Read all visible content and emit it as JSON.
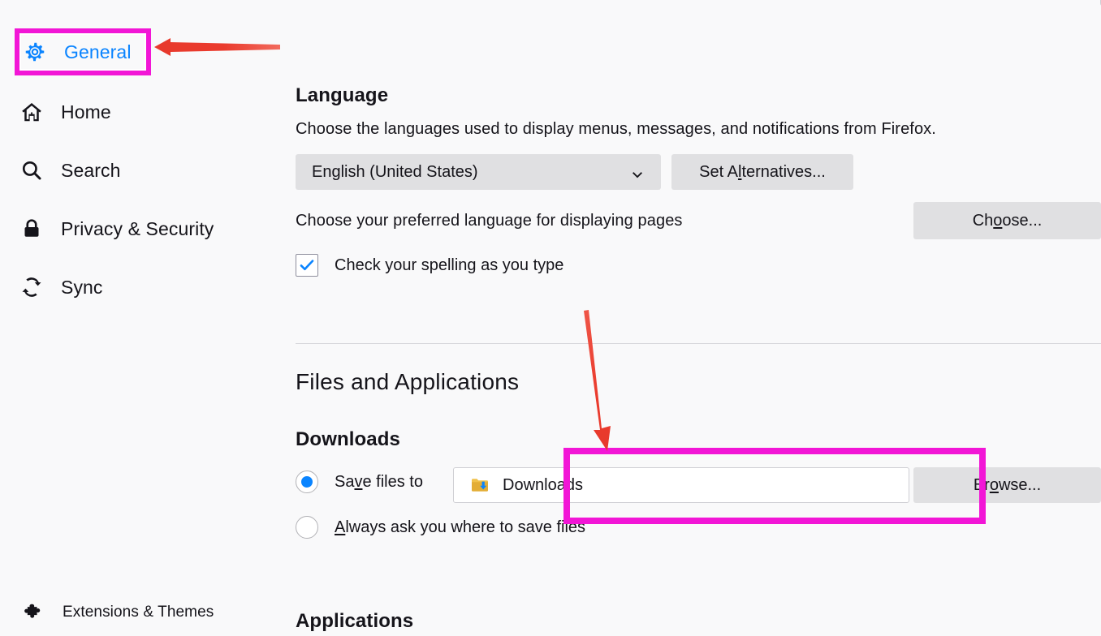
{
  "app": {
    "name": "Firefox Settings",
    "accent_blue": "#0a84ff",
    "highlight_magenta": "#f216d6",
    "annotation_red": "#e8392c",
    "page_background": "#f9f9fa"
  },
  "sidebar": {
    "items": [
      {
        "id": "general",
        "label": "General",
        "icon": "gear-icon",
        "selected": true
      },
      {
        "id": "home",
        "label": "Home",
        "icon": "home-icon",
        "selected": false
      },
      {
        "id": "search",
        "label": "Search",
        "icon": "search-icon",
        "selected": false
      },
      {
        "id": "privacy",
        "label": "Privacy & Security",
        "icon": "lock-icon",
        "selected": false
      },
      {
        "id": "sync",
        "label": "Sync",
        "icon": "sync-icon",
        "selected": false
      }
    ],
    "footer": {
      "label": "Extensions & Themes",
      "icon": "puzzle-piece-icon"
    }
  },
  "search": {
    "placeholder": ""
  },
  "language_section": {
    "title": "Language",
    "description": "Choose the languages used to display menus, messages, and notifications from Firefox.",
    "locale_select": {
      "value": "English (United States)"
    },
    "set_alternatives_button": "Set Alternatives...",
    "preferred_language_text": "Choose your preferred language for displaying pages",
    "choose_button": "Choose...",
    "spellcheck_checkbox": {
      "label": "Check your spelling as you type",
      "checked": true
    }
  },
  "files_section": {
    "title": "Files and Applications",
    "downloads_title": "Downloads",
    "save_files_to": {
      "label": "Save files to",
      "selected": true
    },
    "download_dir": {
      "value": "Downloads",
      "icon": "downloads-folder-icon"
    },
    "browse_button": "Browse...",
    "always_ask": {
      "label": "Always ask you where to save files",
      "selected": false
    },
    "applications_title": "Applications"
  },
  "annotations": {
    "general_highlight": "magenta box around General sidebar item",
    "downloads_highlight": "magenta box around Save files to row",
    "arrow_to_general": "red left-pointing arrow",
    "arrow_to_downloads": "red down-pointing arrow"
  }
}
